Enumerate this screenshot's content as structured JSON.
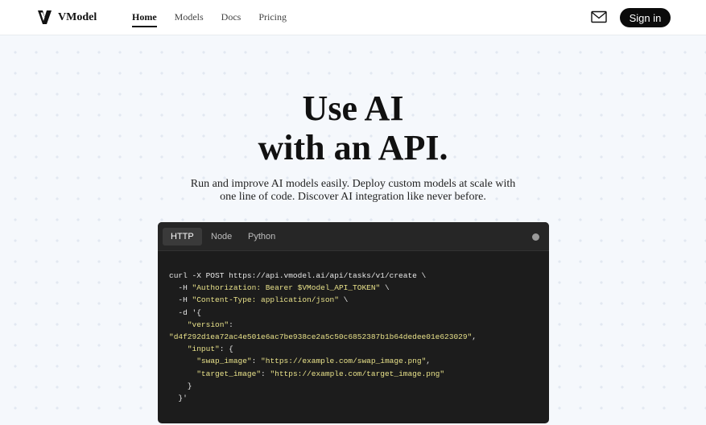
{
  "nav": {
    "brand": "VModel",
    "links": [
      "Home",
      "Models",
      "Docs",
      "Pricing"
    ],
    "active": "Home",
    "signin_label": "Sign in"
  },
  "hero": {
    "title_line1": "Use AI",
    "title_line2": "with an API.",
    "subtitle": "Run and improve AI models easily. Deploy custom models at scale with one line of code. Discover AI integration like never before."
  },
  "code_panel": {
    "tabs": [
      "HTTP",
      "Node",
      "Python"
    ],
    "active_tab": "HTTP",
    "lines": [
      [
        {
          "t": "curl -X POST https://api.vmodel.ai/api/tasks/v1/create \\",
          "s": false
        }
      ],
      [
        {
          "t": "  -H ",
          "s": false
        },
        {
          "t": "\"Authorization: Bearer $VModel_API_TOKEN\"",
          "s": true
        },
        {
          "t": " \\",
          "s": false
        }
      ],
      [
        {
          "t": "  -H ",
          "s": false
        },
        {
          "t": "\"Content-Type: application/json\"",
          "s": true
        },
        {
          "t": " \\",
          "s": false
        }
      ],
      [
        {
          "t": "  -d '{",
          "s": false
        }
      ],
      [
        {
          "t": "    ",
          "s": false
        },
        {
          "t": "\"version\"",
          "s": true
        },
        {
          "t": ":",
          "s": false
        }
      ],
      [
        {
          "t": "\"d4f292d1ea72ac4e501e6ac7be938ce2a5c50c6852387b1b64dedee01e623029\"",
          "s": true
        },
        {
          "t": ",",
          "s": false
        }
      ],
      [
        {
          "t": "    ",
          "s": false
        },
        {
          "t": "\"input\"",
          "s": true
        },
        {
          "t": ": {",
          "s": false
        }
      ],
      [
        {
          "t": "      ",
          "s": false
        },
        {
          "t": "\"swap_image\"",
          "s": true
        },
        {
          "t": ": ",
          "s": false
        },
        {
          "t": "\"https://example.com/swap_image.png\"",
          "s": true
        },
        {
          "t": ",",
          "s": false
        }
      ],
      [
        {
          "t": "      ",
          "s": false
        },
        {
          "t": "\"target_image\"",
          "s": true
        },
        {
          "t": ": ",
          "s": false
        },
        {
          "t": "\"https://example.com/target_image.png\"",
          "s": true
        }
      ],
      [
        {
          "t": "    }",
          "s": false
        }
      ],
      [
        {
          "t": "  }'",
          "s": false
        }
      ]
    ]
  },
  "colors": {
    "accent_dark": "#0b0b0b",
    "code_bg": "#1c1c1c",
    "code_string": "#e9e28a",
    "page_bg": "#f5f8fc"
  },
  "icons": [
    "vmodel-logo-icon",
    "mail-icon"
  ]
}
